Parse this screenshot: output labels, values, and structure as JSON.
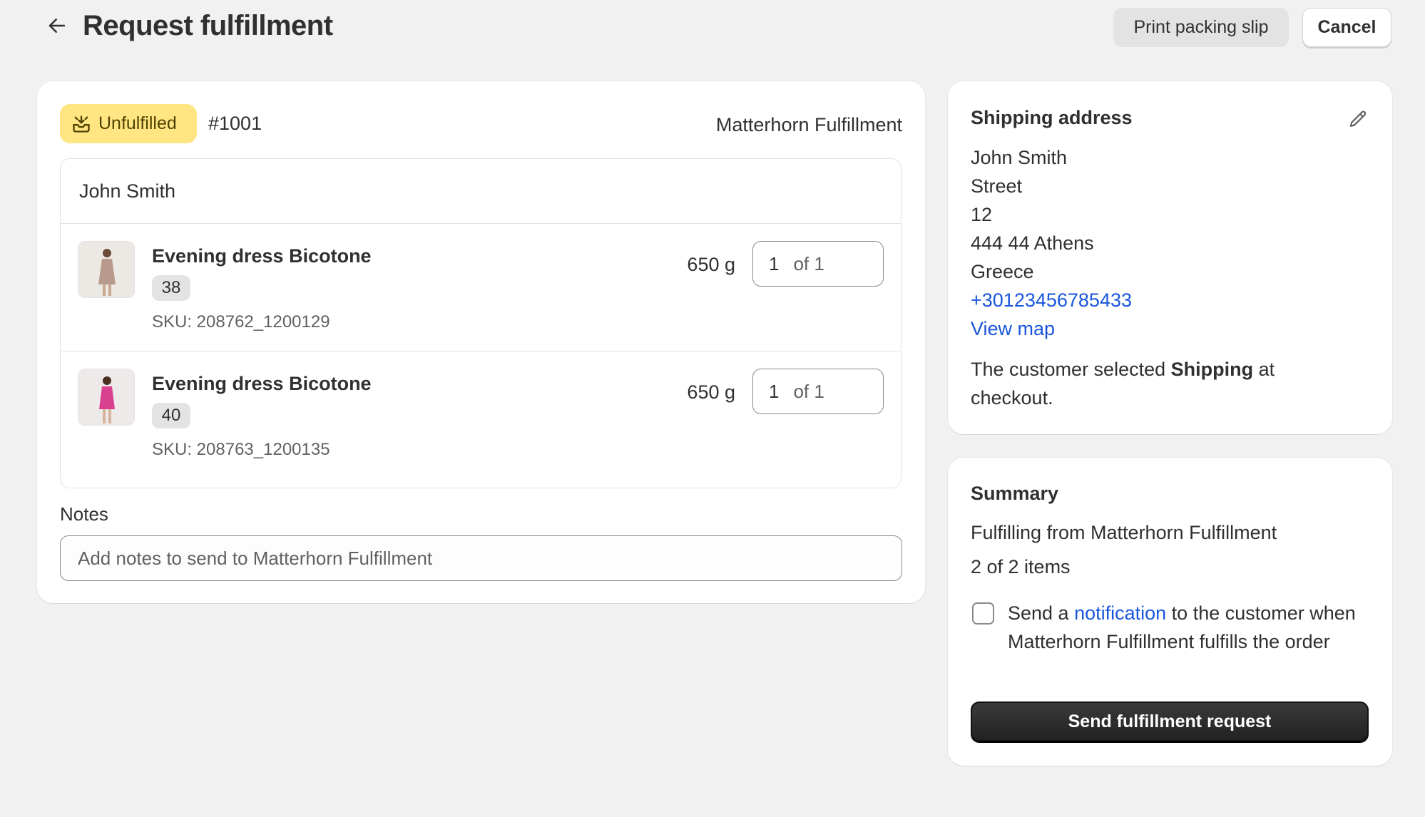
{
  "header": {
    "title": "Request fulfillment",
    "print_label": "Print packing slip",
    "cancel_label": "Cancel"
  },
  "order": {
    "status": "Unfulfilled",
    "number": "#1001",
    "location": "Matterhorn Fulfillment",
    "customer": "John Smith",
    "items": [
      {
        "title": "Evening dress Bicotone",
        "variant": "38",
        "sku": "SKU: 208762_1200129",
        "weight": "650 g",
        "quantity": "1",
        "quantity_of": "of 1",
        "image_color": "#b89a8c"
      },
      {
        "title": "Evening dress Bicotone",
        "variant": "40",
        "sku": "SKU: 208763_1200135",
        "weight": "650 g",
        "quantity": "1",
        "quantity_of": "of 1",
        "image_color": "#d9408f"
      }
    ],
    "notes_label": "Notes",
    "notes_placeholder": "Add notes to send to Matterhorn Fulfillment"
  },
  "shipping": {
    "heading": "Shipping address",
    "lines": [
      "John Smith",
      "Street",
      "12",
      "444 44 Athens",
      "Greece"
    ],
    "phone": "+30123456785433",
    "map_link": "View map",
    "note_prefix": "The customer selected ",
    "note_method": "Shipping",
    "note_suffix": " at checkout."
  },
  "summary": {
    "heading": "Summary",
    "fulfilling_from": "Fulfilling from Matterhorn Fulfillment",
    "item_count": "2 of 2 items",
    "notify_prefix": "Send a ",
    "notify_link": "notification",
    "notify_suffix": " to the customer when Matterhorn Fulfillment fulfills the order",
    "notify_checked": false,
    "send_label": "Send fulfillment request"
  },
  "colors": {
    "badge_bg": "#ffe682",
    "link": "#1a56db",
    "primary_button": "#303030"
  }
}
